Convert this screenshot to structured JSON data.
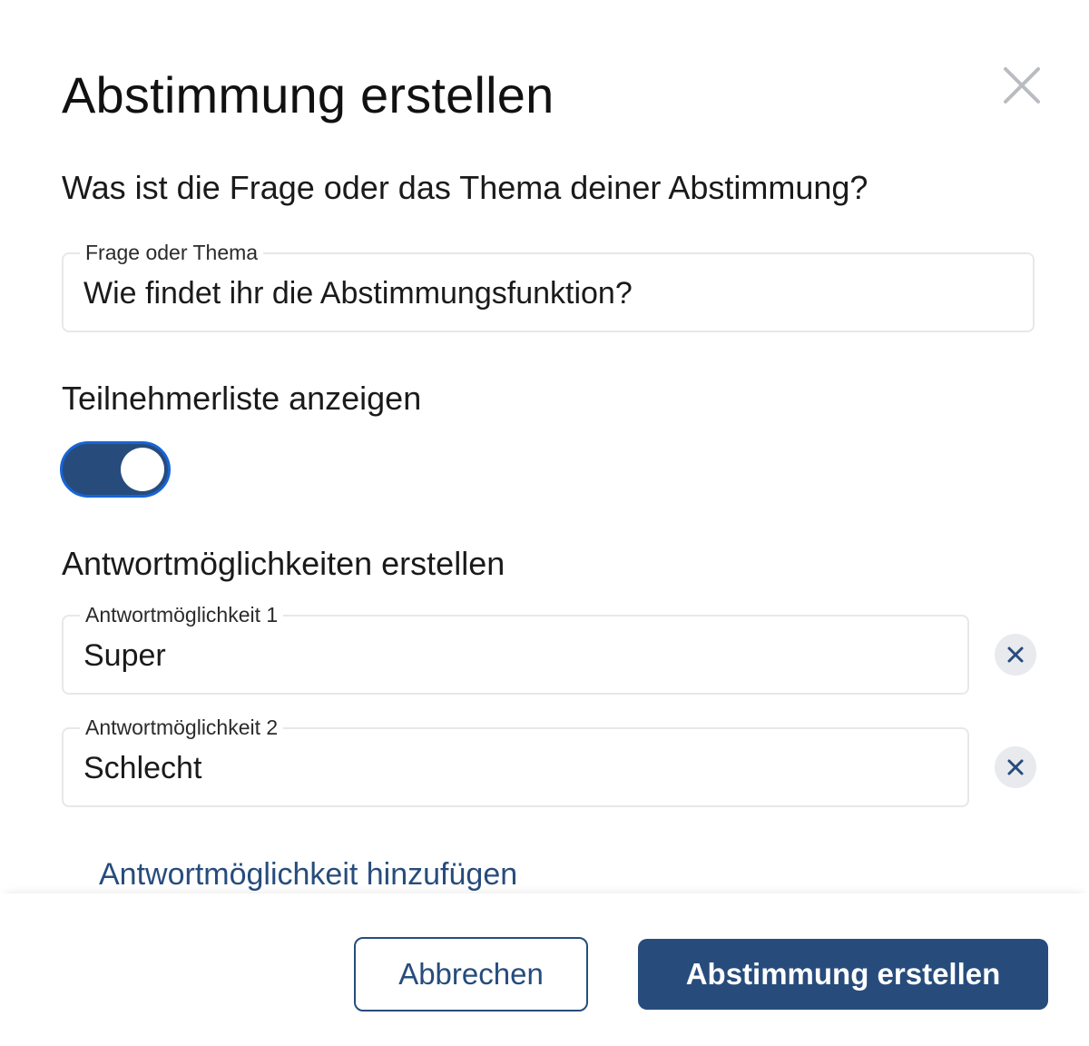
{
  "dialog": {
    "title": "Abstimmung erstellen",
    "close_icon": "close-icon"
  },
  "question": {
    "prompt": "Was ist die Frage oder das Thema deiner Abstimmung?",
    "field_label": "Frage oder Thema",
    "field_value": "Wie findet ihr die Abstimmungsfunktion?"
  },
  "participants": {
    "label": "Teilnehmerliste anzeigen",
    "toggle_on": true
  },
  "answers": {
    "heading": "Antwortmöglichkeiten erstellen",
    "options": [
      {
        "label": "Antwortmöglichkeit 1",
        "value": "Super"
      },
      {
        "label": "Antwortmöglichkeit 2",
        "value": "Schlecht"
      }
    ],
    "add_link": "Antwortmöglichkeit hinzufügen"
  },
  "footer": {
    "cancel_label": "Abbrechen",
    "submit_label": "Abstimmung erstellen"
  },
  "colors": {
    "primary": "#274c7c",
    "toggle_border": "#1765d6",
    "field_border": "#e6e8eb"
  }
}
